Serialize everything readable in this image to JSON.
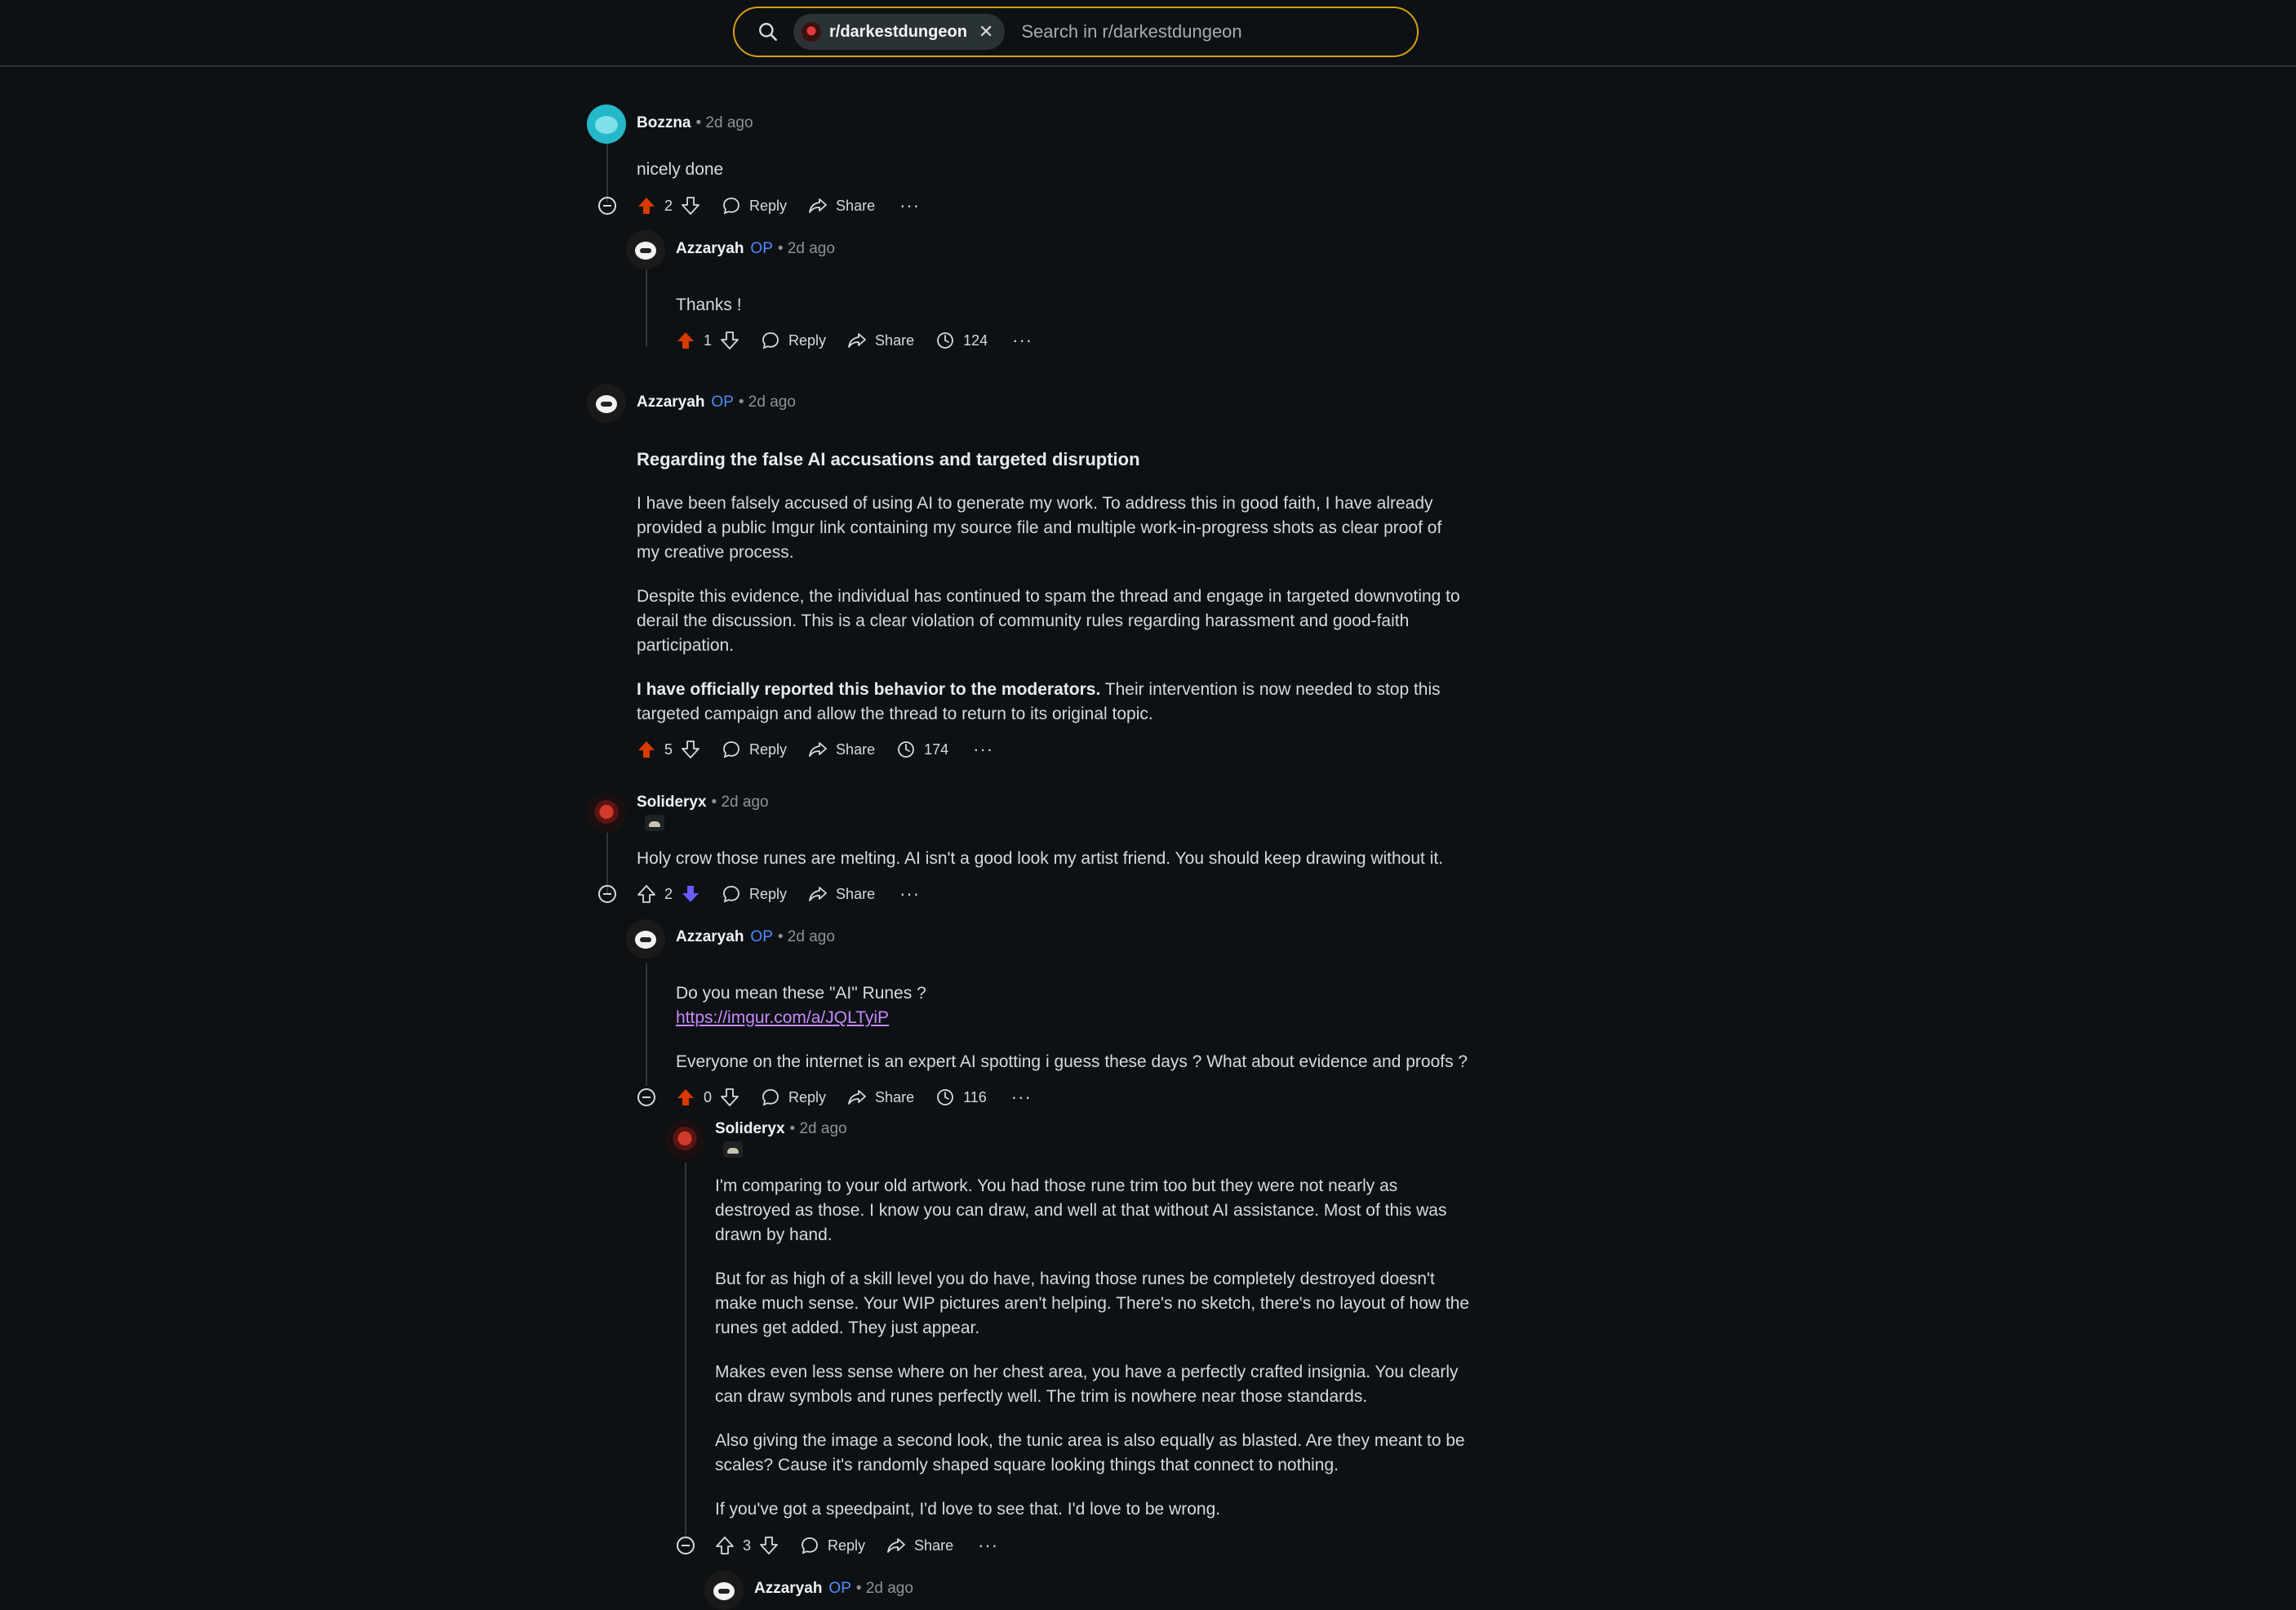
{
  "search": {
    "chip_label": "r/darkestdungeon",
    "placeholder": "Search in r/darkestdungeon"
  },
  "comments": [
    {
      "author": "Bozzna",
      "op": "",
      "time": "• 2d ago",
      "paragraphs": [
        "nicely done"
      ],
      "votes": "2",
      "reply": "Reply",
      "share": "Share",
      "more": "···"
    },
    {
      "author": "Azzaryah",
      "op": "OP",
      "time": "• 2d ago",
      "paragraphs": [
        "Thanks !"
      ],
      "votes": "1",
      "reply": "Reply",
      "share": "Share",
      "views": "124",
      "more": "···"
    },
    {
      "author": "Azzaryah",
      "op": "OP",
      "time": "• 2d ago",
      "heading": "Regarding the false AI accusations and targeted disruption",
      "paragraphs": [
        "I have been falsely accused of using AI to generate my work. To address this in good faith, I have already provided a public Imgur link containing my source file and multiple work-in-progress shots as clear proof of my creative process.",
        "Despite this evidence, the individual has continued to spam the thread and engage in targeted downvoting to derail the discussion. This is a clear violation of community rules regarding harassment and good-faith participation."
      ],
      "bold_lead": "I have officially reported this behavior to the moderators.",
      "bold_rest": " Their intervention is now needed to stop this targeted campaign and allow the thread to return to its original topic.",
      "votes": "5",
      "reply": "Reply",
      "share": "Share",
      "views": "174",
      "more": "···"
    },
    {
      "author": "Solideryx",
      "op": "",
      "time": "• 2d ago",
      "paragraphs": [
        "Holy crow those runes are melting. AI isn't a good look my artist friend. You should keep drawing without it."
      ],
      "votes": "2",
      "reply": "Reply",
      "share": "Share",
      "more": "···"
    },
    {
      "author": "Azzaryah",
      "op": "OP",
      "time": "• 2d ago",
      "line1": "Do you mean these \"AI\" Runes ?",
      "link": "https://imgur.com/a/JQLTyiP",
      "paragraphs": [
        "Everyone on the internet is an expert AI spotting i guess these days ? What about evidence and proofs ?"
      ],
      "votes": "0",
      "reply": "Reply",
      "share": "Share",
      "views": "116",
      "more": "···"
    },
    {
      "author": "Solideryx",
      "op": "",
      "time": "• 2d ago",
      "paragraphs": [
        "I'm comparing to your old artwork. You had those rune trim too but they were not nearly as destroyed as those. I know you can draw, and well at that without AI assistance. Most of this was drawn by hand.",
        "But for as high of a skill level you do have, having those runes be completely destroyed doesn't make much sense. Your WIP pictures aren't helping. There's no sketch, there's no layout of how the runes get added. They just appear.",
        "Makes even less sense where on her chest area, you have a perfectly crafted insignia. You clearly can draw symbols and runes perfectly well. The trim is nowhere near those standards.",
        "Also giving the image a second look, the tunic area is also equally as blasted. Are they meant to be scales? Cause it's randomly shaped square looking things that connect to nothing.",
        "If you've got a speedpaint, I'd love to see that. I'd love to be wrong."
      ],
      "votes": "3",
      "reply": "Reply",
      "share": "Share",
      "more": "···"
    },
    {
      "author": "Azzaryah",
      "op": "OP",
      "time": "• 2d ago"
    }
  ],
  "colors": {
    "upvote_active": "#d93a00",
    "downvote_active": "#6a5cff",
    "op_blue": "#4f8cff",
    "search_border": "#d4a017",
    "link": "#c589ff"
  }
}
